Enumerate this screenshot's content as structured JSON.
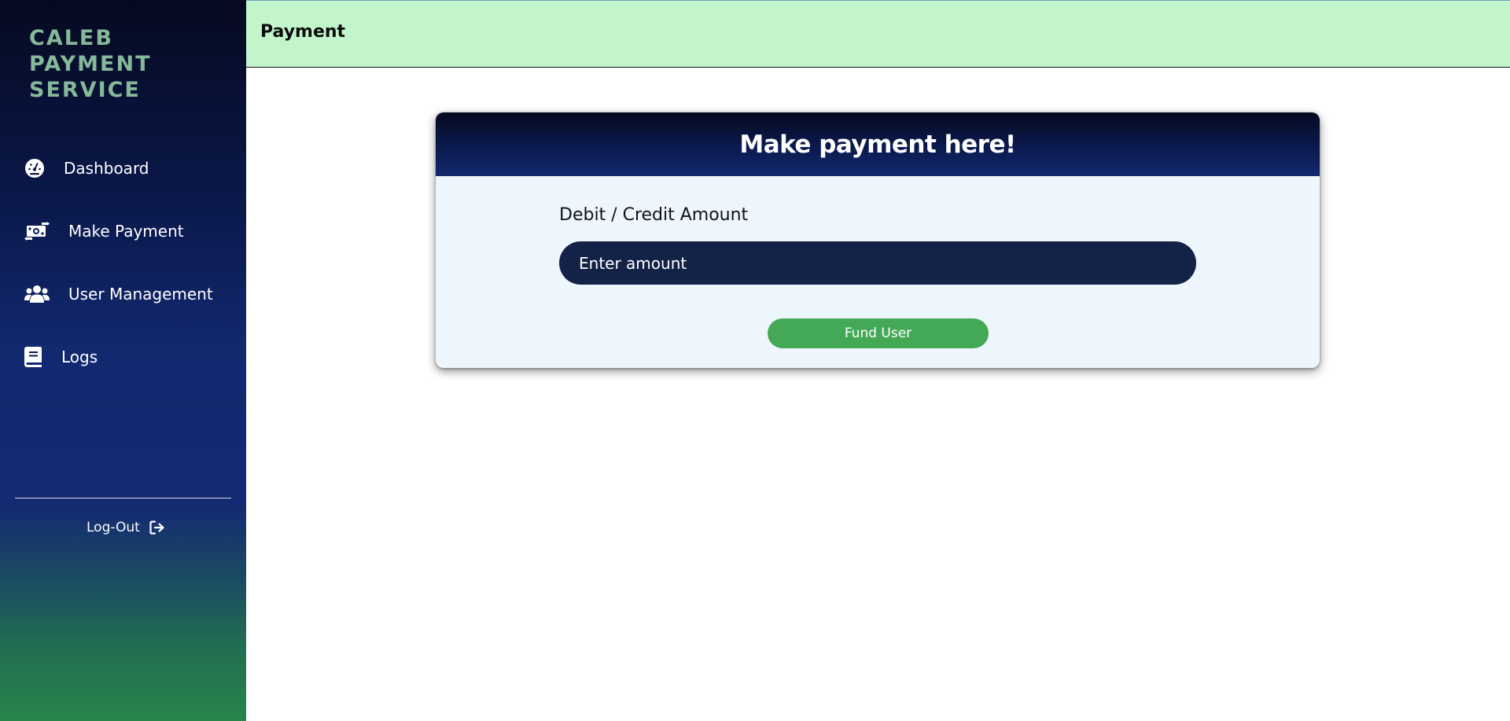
{
  "sidebar": {
    "brand": "CALEB PAYMENT SERVICE",
    "items": [
      {
        "label": "Dashboard",
        "icon": "dashboard-gauge-icon"
      },
      {
        "label": "Make Payment",
        "icon": "money-transfer-icon"
      },
      {
        "label": "User Management",
        "icon": "users-icon"
      },
      {
        "label": "Logs",
        "icon": "book-icon"
      }
    ],
    "logout": {
      "label": "Log-Out",
      "icon": "sign-out-icon"
    }
  },
  "header": {
    "title": "Payment"
  },
  "card": {
    "title": "Make payment here!",
    "amount_label": "Debit / Credit Amount",
    "amount_value": "",
    "amount_placeholder": "Enter amount",
    "submit_label": "Fund User"
  },
  "colors": {
    "brand_text": "#85b99a",
    "header_bg": "#c2f5cc",
    "card_bg": "#eef6fd",
    "input_bg": "#142247",
    "button_bg": "#44a957",
    "sidebar_top": "#050a20",
    "sidebar_mid": "#12286f",
    "sidebar_bottom": "#278549"
  }
}
